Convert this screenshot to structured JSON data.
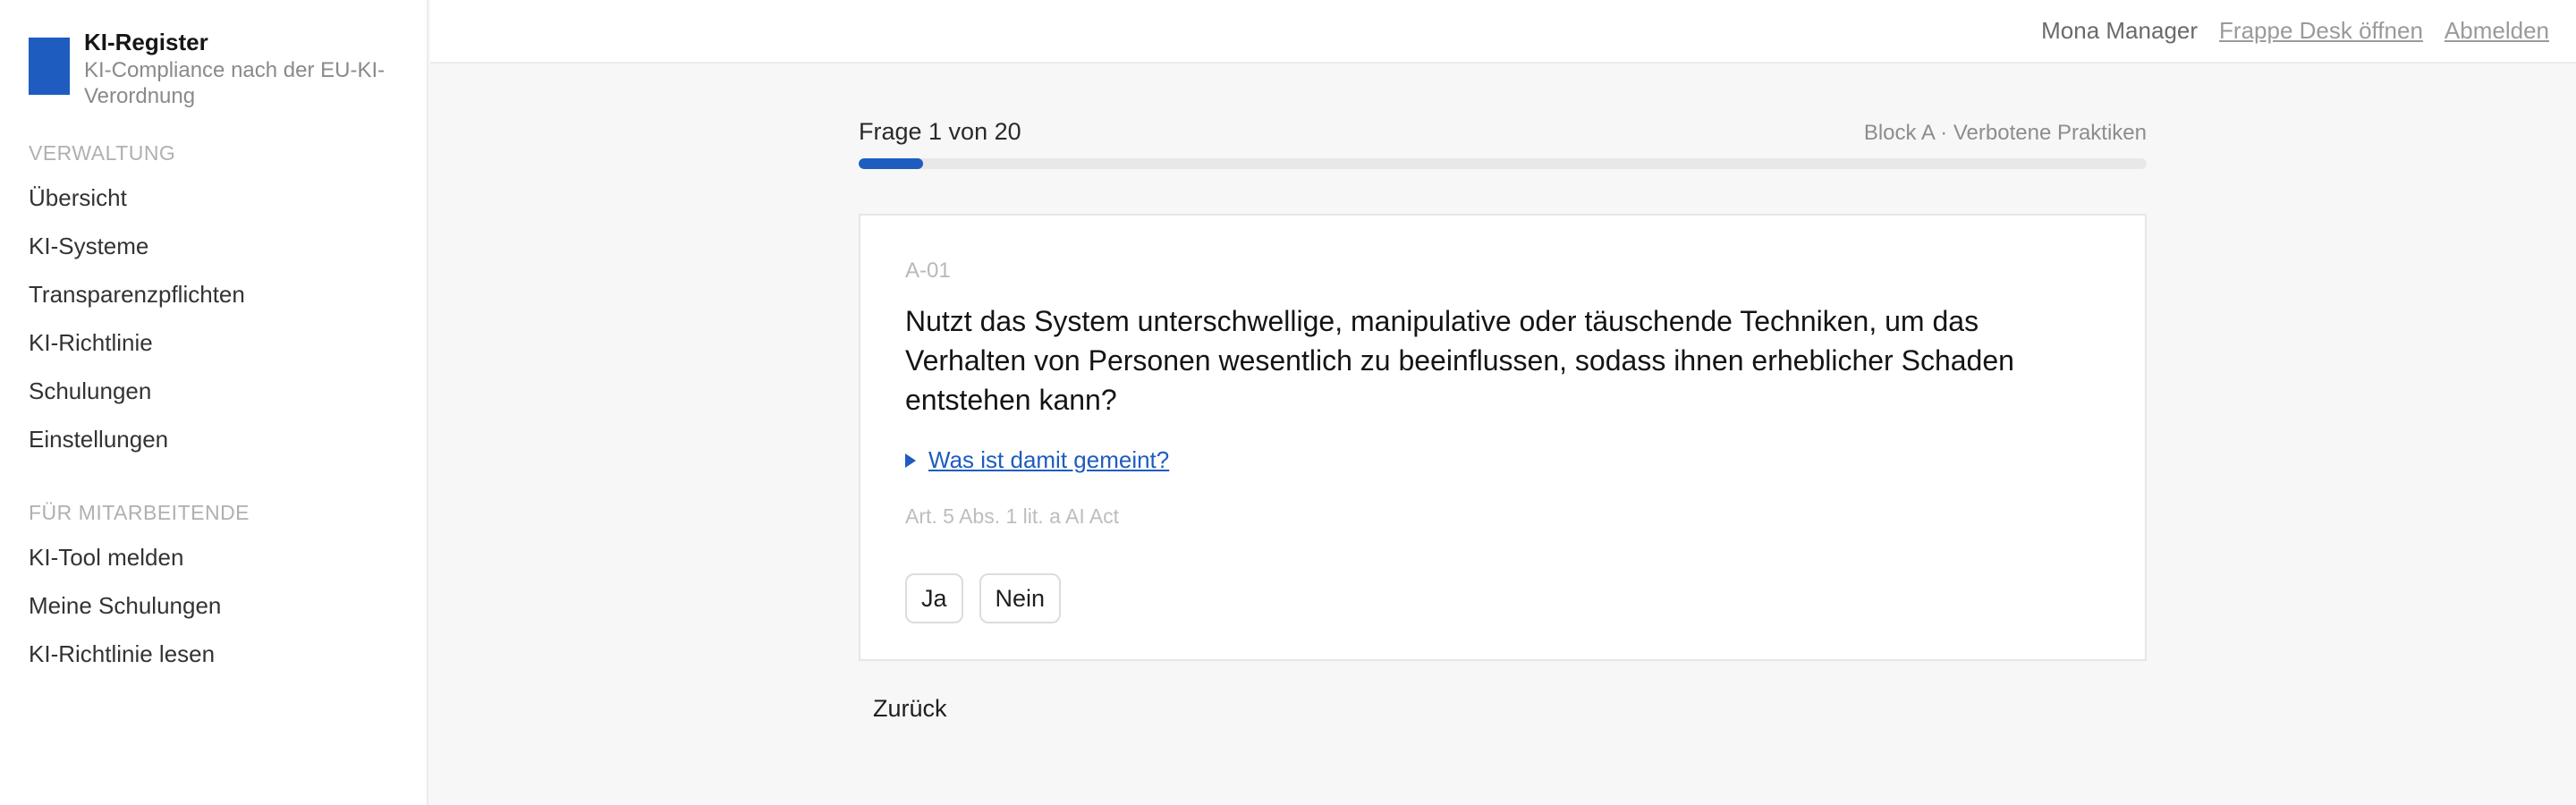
{
  "app": {
    "title": "KI-Register",
    "subtitle": "KI-Compliance nach der EU-KI-Verordnung",
    "brand_color": "#1e5cbf"
  },
  "sidebar": {
    "sections": [
      {
        "heading": "Verwaltung",
        "items": [
          "Übersicht",
          "KI-Systeme",
          "Transparenzpflichten",
          "KI-Richtlinie",
          "Schulungen",
          "Einstellungen"
        ]
      },
      {
        "heading": "Für Mitarbeitende",
        "items": [
          "KI-Tool melden",
          "Meine Schulungen",
          "KI-Richtlinie lesen"
        ]
      }
    ]
  },
  "topbar": {
    "user": "Mona Manager",
    "desk_link": "Frappe Desk öffnen",
    "logout": "Abmelden"
  },
  "progress": {
    "label": "Frage 1 von 20",
    "current": 1,
    "total": 20,
    "block": "Block A · Verbotene Praktiken"
  },
  "question": {
    "id": "A-01",
    "text": "Nutzt das System unterschwellige, manipulative oder täuschende Techniken, um das Verhalten von Personen wesentlich zu beeinflussen, sodass ihnen erheblicher Schaden entstehen kann?",
    "details_label": "Was ist damit gemeint?",
    "legal_ref": "Art. 5 Abs. 1 lit. a AI Act",
    "answers": [
      "Ja",
      "Nein"
    ]
  },
  "nav": {
    "back": "Zurück"
  }
}
